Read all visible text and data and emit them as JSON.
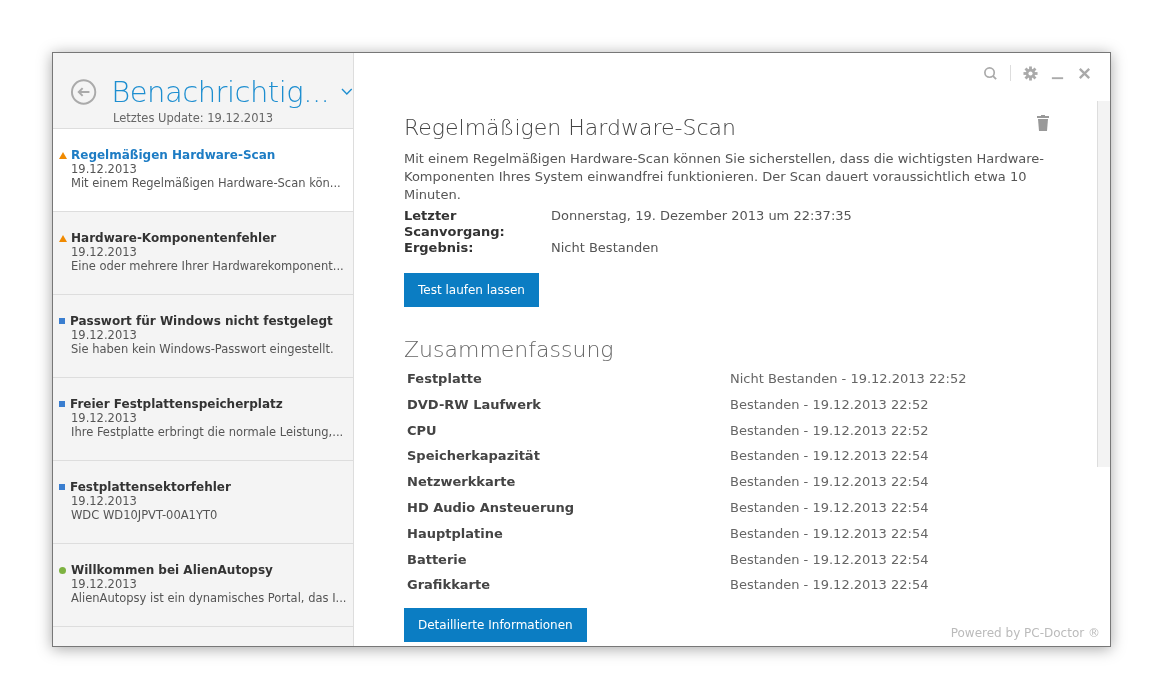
{
  "sidebar": {
    "title": "Benachrichtig...",
    "subtitle": "Letztes Update: 19.12.2013",
    "items": [
      {
        "kind": "warning",
        "title": "Regelmäßigen Hardware-Scan",
        "date": "19.12.2013",
        "summary": "Mit einem Regelmäßigen Hardware-Scan kön...",
        "selected": true
      },
      {
        "kind": "warning",
        "title": "Hardware-Komponentenfehler",
        "date": "19.12.2013",
        "summary": "Eine oder mehrere Ihrer Hardwarekomponent...",
        "selected": false
      },
      {
        "kind": "info",
        "title": "Passwort für Windows nicht festgelegt",
        "date": "19.12.2013",
        "summary": "Sie haben kein Windows-Passwort eingestellt.",
        "selected": false
      },
      {
        "kind": "info",
        "title": "Freier Festplattenspeicherplatz",
        "date": "19.12.2013",
        "summary": "Ihre Festplatte erbringt die normale Leistung,...",
        "selected": false
      },
      {
        "kind": "info",
        "title": "Festplattensektorfehler",
        "date": "19.12.2013",
        "summary": "WDC WD10JPVT-00A1YT0",
        "selected": false
      },
      {
        "kind": "success",
        "title": "Willkommen bei AlienAutopsy",
        "date": "19.12.2013",
        "summary": "AlienAutopsy ist ein dynamisches Portal, das I...",
        "selected": false
      }
    ]
  },
  "detail": {
    "title": "Regelmäßigen Hardware-Scan",
    "description": "Mit einem Regelmäßigen Hardware-Scan können Sie sicherstellen, dass die wichtigsten Hardware-Komponenten Ihres System einwandfrei funktionieren. Der Scan dauert voraussichtlich etwa 10 Minuten.",
    "fields": [
      {
        "label": "Letzter Scanvorgang:",
        "value": "Donnerstag, 19. Dezember 2013 um 22:37:35"
      },
      {
        "label": "Ergebnis:",
        "value": "Nicht Bestanden"
      }
    ],
    "run_button": "Test laufen lassen",
    "summary_title": "Zusammenfassung",
    "summary_rows": [
      {
        "component": "Festplatte",
        "result": "Nicht Bestanden - 19.12.2013 22:52"
      },
      {
        "component": "DVD-RW Laufwerk",
        "result": "Bestanden - 19.12.2013 22:52"
      },
      {
        "component": "CPU",
        "result": "Bestanden - 19.12.2013 22:52"
      },
      {
        "component": "Speicherkapazität",
        "result": "Bestanden - 19.12.2013 22:54"
      },
      {
        "component": "Netzwerkkarte",
        "result": "Bestanden - 19.12.2013 22:54"
      },
      {
        "component": "HD Audio Ansteuerung",
        "result": "Bestanden - 19.12.2013 22:54"
      },
      {
        "component": "Hauptplatine",
        "result": "Bestanden - 19.12.2013 22:54"
      },
      {
        "component": "Batterie",
        "result": "Bestanden - 19.12.2013 22:54"
      },
      {
        "component": "Grafikkarte",
        "result": "Bestanden - 19.12.2013 22:54"
      }
    ],
    "details_button": "Detaillierte Informationen"
  },
  "footer": "Powered by PC-Doctor ®"
}
